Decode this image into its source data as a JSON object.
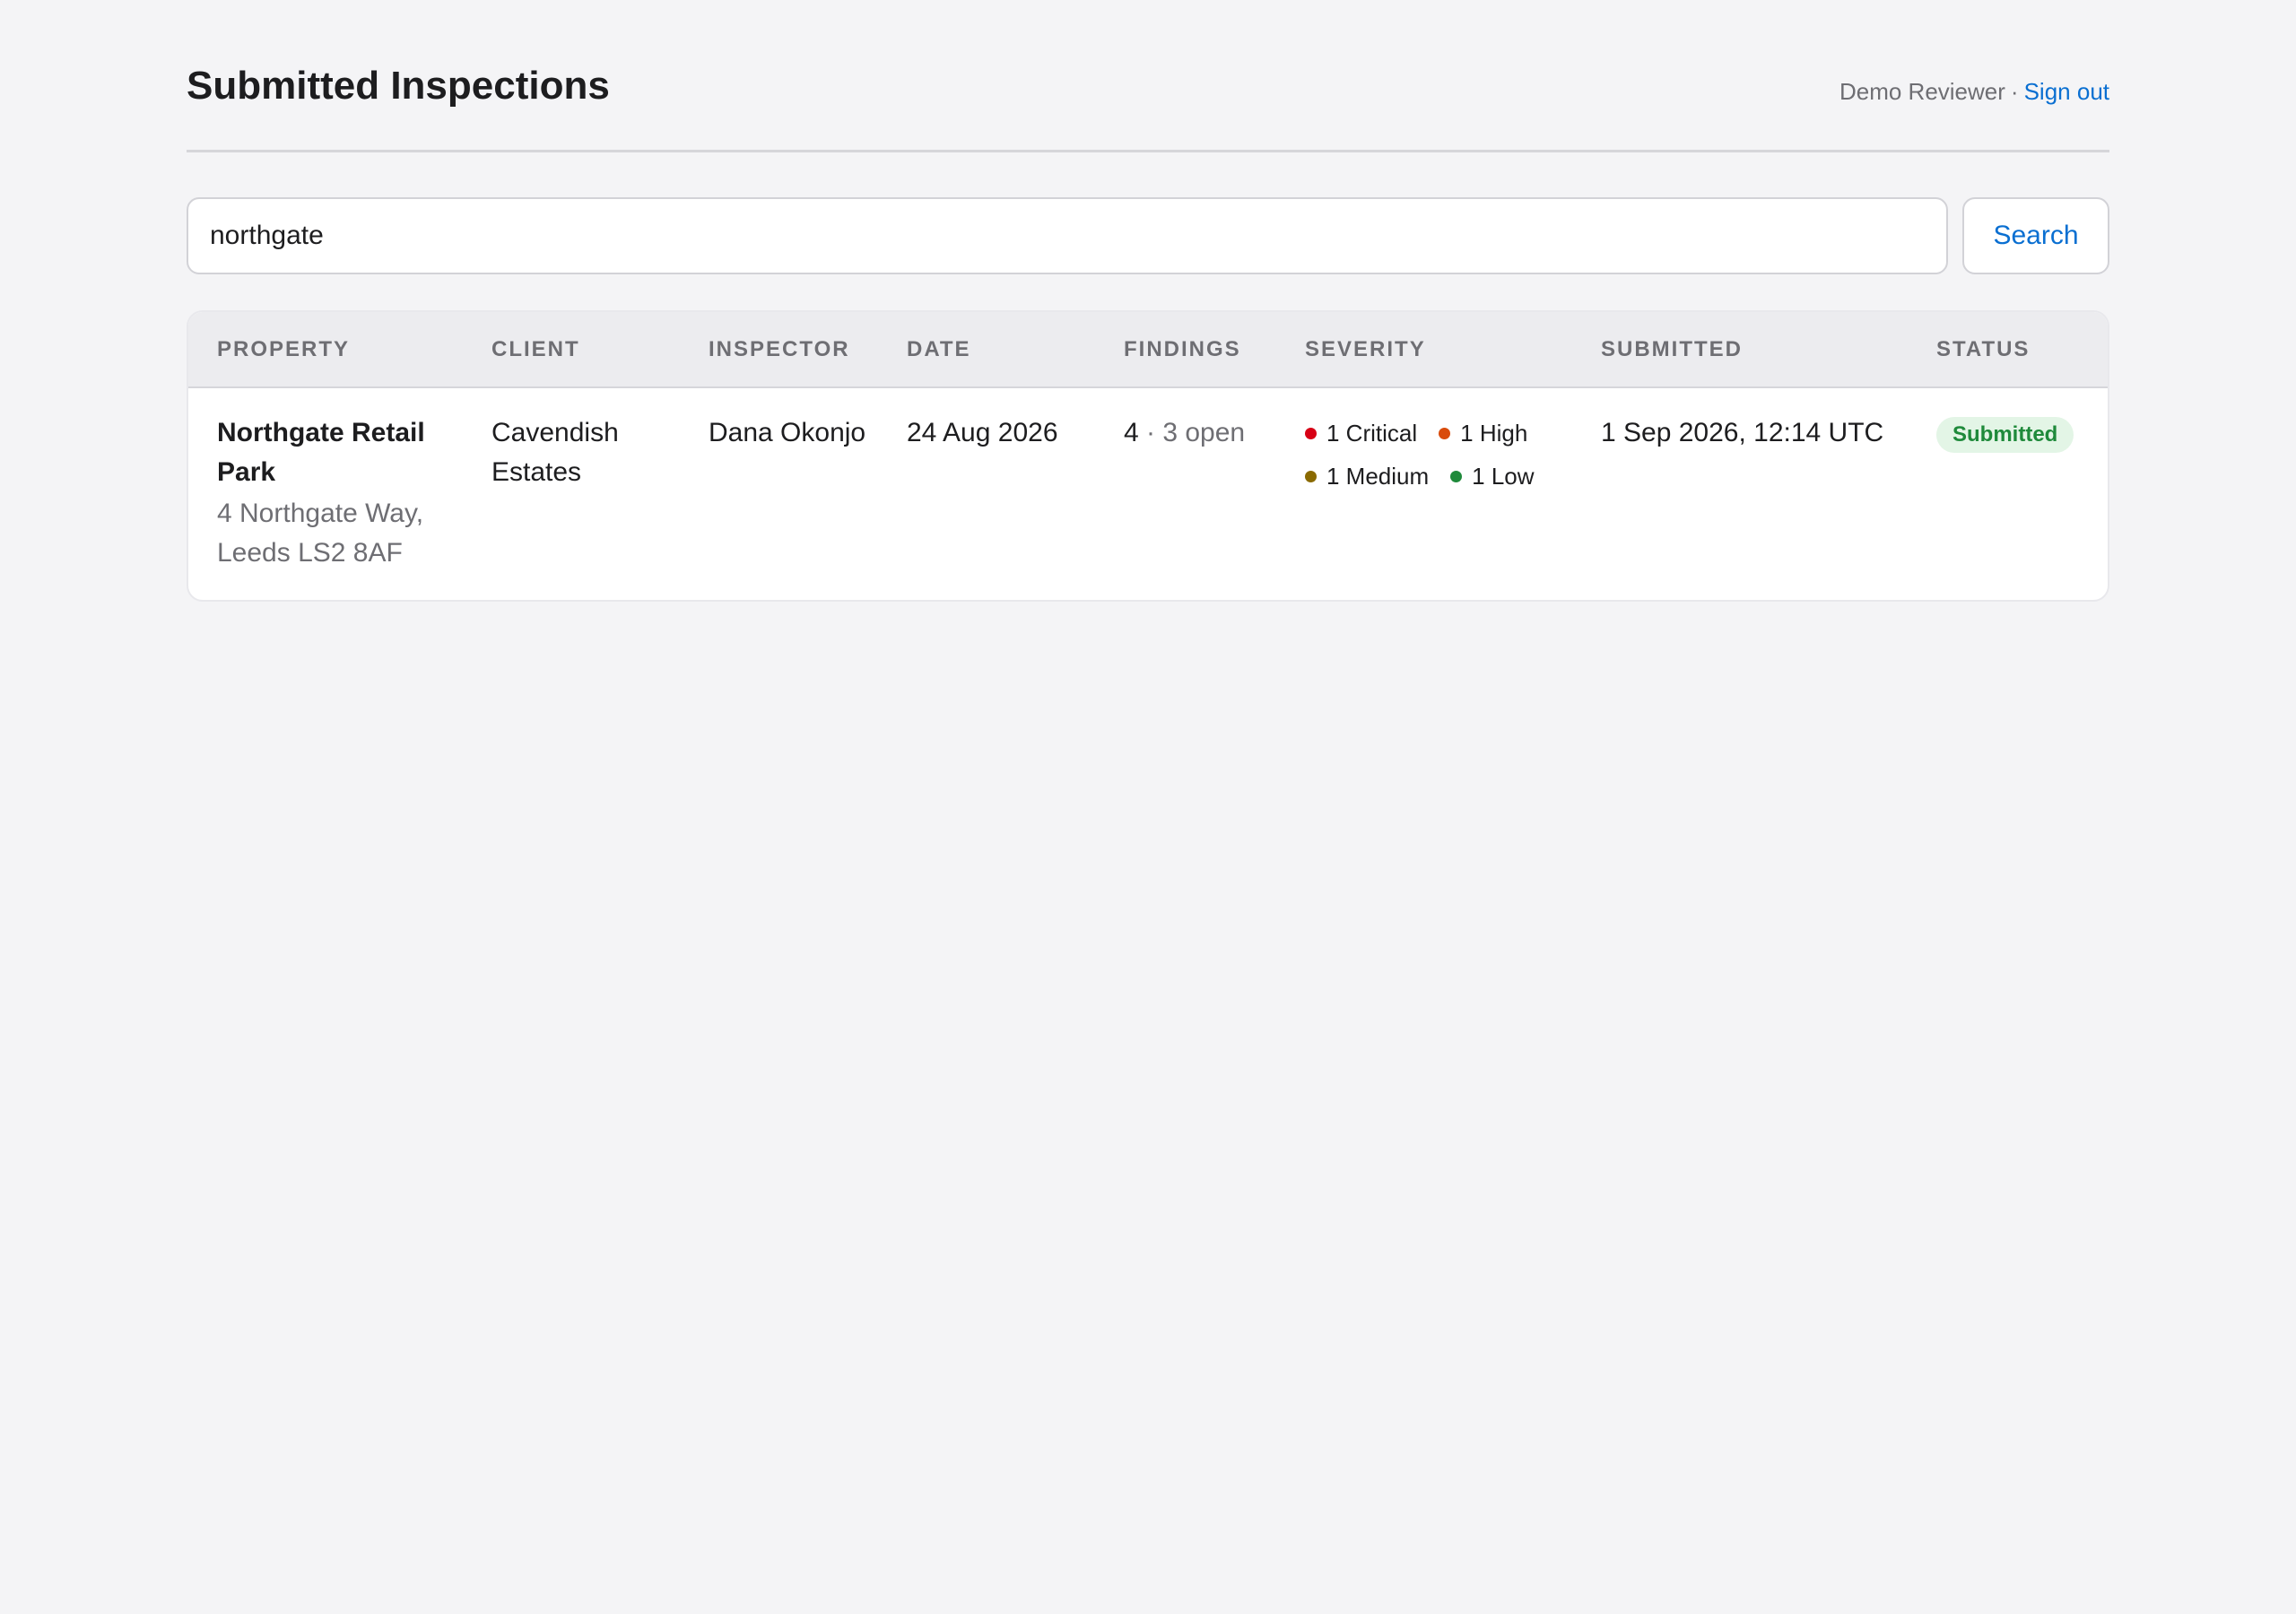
{
  "header": {
    "title": "Submitted Inspections",
    "user_name": "Demo Reviewer",
    "separator": "·",
    "sign_out_label": "Sign out"
  },
  "search": {
    "value": "northgate",
    "button_label": "Search"
  },
  "table": {
    "columns": [
      "PROPERTY",
      "CLIENT",
      "INSPECTOR",
      "DATE",
      "FINDINGS",
      "SEVERITY",
      "SUBMITTED",
      "STATUS"
    ],
    "rows": [
      {
        "property_name": "Northgate Retail Park",
        "property_address": "4 Northgate Way, Leeds LS2 8AF",
        "client": "Cavendish Estates",
        "inspector": "Dana Okonjo",
        "date": "24 Aug 2026",
        "findings_count": "4",
        "findings_open": "· 3 open",
        "severity": [
          {
            "label": "1 Critical",
            "color": "#d70015"
          },
          {
            "label": "1 High",
            "color": "#d94b0b"
          },
          {
            "label": "1 Medium",
            "color": "#8a6a00"
          },
          {
            "label": "1 Low",
            "color": "#1f8a3b"
          }
        ],
        "submitted": "1 Sep 2026, 12:14 UTC",
        "status": "Submitted"
      }
    ]
  },
  "colors": {
    "accent": "#0a6fd1",
    "status_submitted_bg": "#e3f5e6",
    "status_submitted_text": "#1f8a3b"
  }
}
